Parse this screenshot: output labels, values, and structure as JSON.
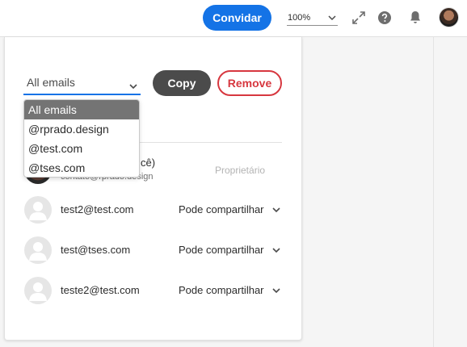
{
  "topbar": {
    "invite_label": "Convidar",
    "zoom_value": "100%",
    "icons": [
      "expand-icon",
      "help-icon",
      "bell-icon"
    ]
  },
  "share": {
    "filter_value": "All emails",
    "copy_label": "Copy",
    "remove_label": "Remove",
    "filter_options": [
      "All emails",
      "@rprado.design",
      "@test.com",
      "@tses.com"
    ],
    "owner": {
      "name_fragment": "cê)",
      "email": "contato@rprado.design",
      "role": "Proprietário"
    },
    "people": [
      {
        "email": "test2@test.com",
        "permission": "Pode compartilhar"
      },
      {
        "email": "test@tses.com",
        "permission": "Pode compartilhar"
      },
      {
        "email": "teste2@test.com",
        "permission": "Pode compartilhar"
      }
    ]
  },
  "colors": {
    "accent": "#1473e6",
    "danger": "#d7373f",
    "dark_button": "#4b4b4b",
    "selected_item": "#747474"
  }
}
